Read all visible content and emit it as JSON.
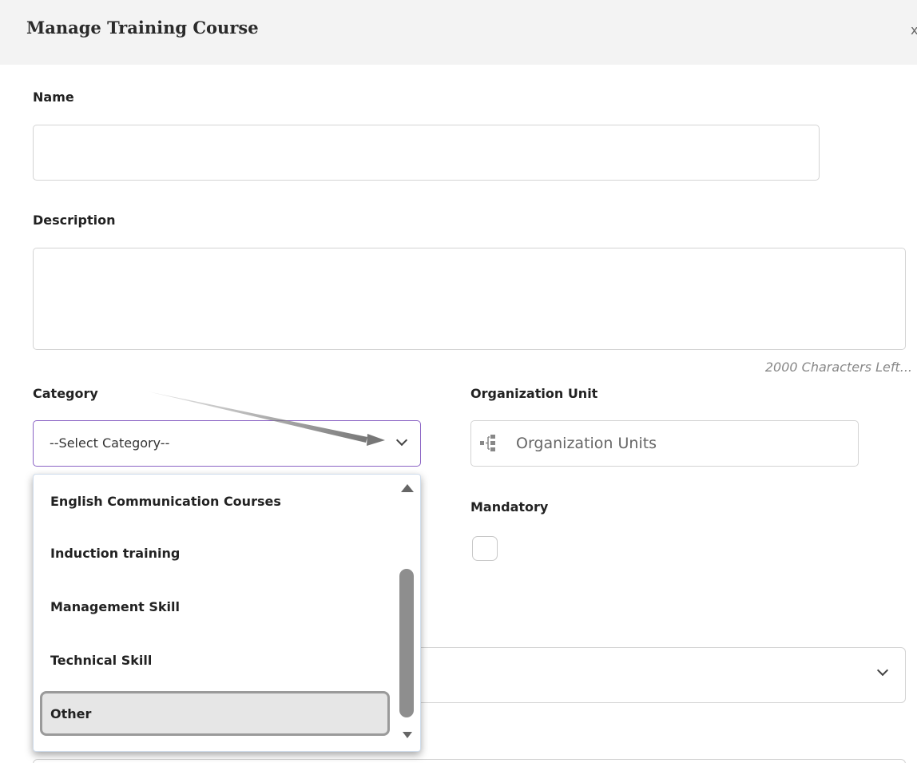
{
  "dialog": {
    "title": "Manage Training Course",
    "close_glyph": "x"
  },
  "form": {
    "name_label": "Name",
    "name_value": "",
    "description_label": "Description",
    "description_value": "",
    "char_count": "2000 Characters Left...",
    "category_label": "Category",
    "category_selected": "--Select Category--",
    "org_unit_label": "Organization Unit",
    "org_unit_placeholder": "Organization Units",
    "mandatory_label": "Mandatory",
    "mandatory_checked": false
  },
  "category_dropdown": {
    "options": [
      "English Communication Courses",
      "Induction training",
      "Management Skill",
      "Technical Skill",
      "Other"
    ],
    "highlighted": "Other"
  },
  "icons": {
    "close": "close-icon",
    "select_chevron": "chevron-down-icon",
    "org_tree": "org-tree-icon",
    "annotation_arrow": "arrow-icon"
  },
  "colors": {
    "header_bg": "#f3f3f3",
    "focus_border": "#8a63c4",
    "highlight_bg": "#e6e6e6"
  }
}
